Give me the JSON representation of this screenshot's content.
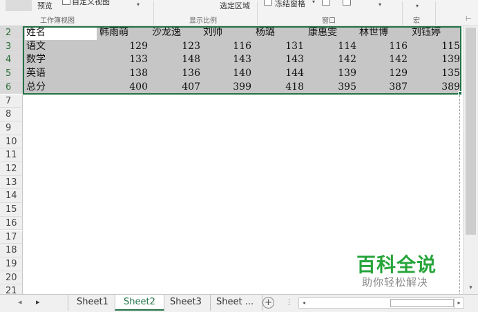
{
  "ribbon": {
    "preview_label": "预览",
    "custom_view_label": "自定义视图",
    "workbook_views_group": "工作簿视图",
    "zoom_to_selection_label": "选定区域",
    "zoom_group": "显示比例",
    "freeze_panes_label": "冻结窗格",
    "window_group": "窗口",
    "macros_group": "宏",
    "dropdown_glyph": "▾",
    "collapse_glyph": "⊢"
  },
  "rows": [
    {
      "header": "2",
      "cells": [
        "姓名",
        "韩雨萌",
        "沙龙逸",
        "刘帅",
        "杨璐",
        "康惠雯",
        "林世博",
        "刘钰婷"
      ]
    },
    {
      "header": "3",
      "cells": [
        "语文",
        "129",
        "123",
        "116",
        "131",
        "114",
        "116",
        "115"
      ]
    },
    {
      "header": "4",
      "cells": [
        "数学",
        "133",
        "148",
        "143",
        "143",
        "142",
        "142",
        "139"
      ]
    },
    {
      "header": "5",
      "cells": [
        "英语",
        "138",
        "136",
        "140",
        "144",
        "139",
        "129",
        "135"
      ]
    },
    {
      "header": "6",
      "cells": [
        "总分",
        "400",
        "407",
        "399",
        "418",
        "395",
        "387",
        "389"
      ]
    },
    {
      "header": "7",
      "cells": []
    },
    {
      "header": "8",
      "cells": []
    },
    {
      "header": "9",
      "cells": []
    },
    {
      "header": "10",
      "cells": []
    },
    {
      "header": "11",
      "cells": []
    },
    {
      "header": "12",
      "cells": []
    },
    {
      "header": "13",
      "cells": []
    },
    {
      "header": "14",
      "cells": []
    },
    {
      "header": "15",
      "cells": []
    },
    {
      "header": "16",
      "cells": []
    },
    {
      "header": "17",
      "cells": []
    },
    {
      "header": "18",
      "cells": []
    },
    {
      "header": "19",
      "cells": []
    },
    {
      "header": "20",
      "cells": []
    },
    {
      "header": "21",
      "cells": []
    }
  ],
  "sheet_tabs": {
    "prev_glyph": "◂",
    "next_glyph": "▸",
    "tabs": [
      "Sheet1",
      "Sheet2",
      "Sheet3",
      "Sheet ..."
    ],
    "active": "Sheet2",
    "add_glyph": "+",
    "more_glyph": "⋮"
  },
  "scroll": {
    "up_glyph": "▴",
    "down_glyph": "▾",
    "left_glyph": "◂",
    "right_glyph": "▸"
  },
  "watermark": {
    "title": "百科全说",
    "subtitle": "助你轻松解决"
  },
  "colors": {
    "accent": "#217346",
    "selection_fill": "#c6c6c6",
    "watermark": "#27a53b"
  }
}
